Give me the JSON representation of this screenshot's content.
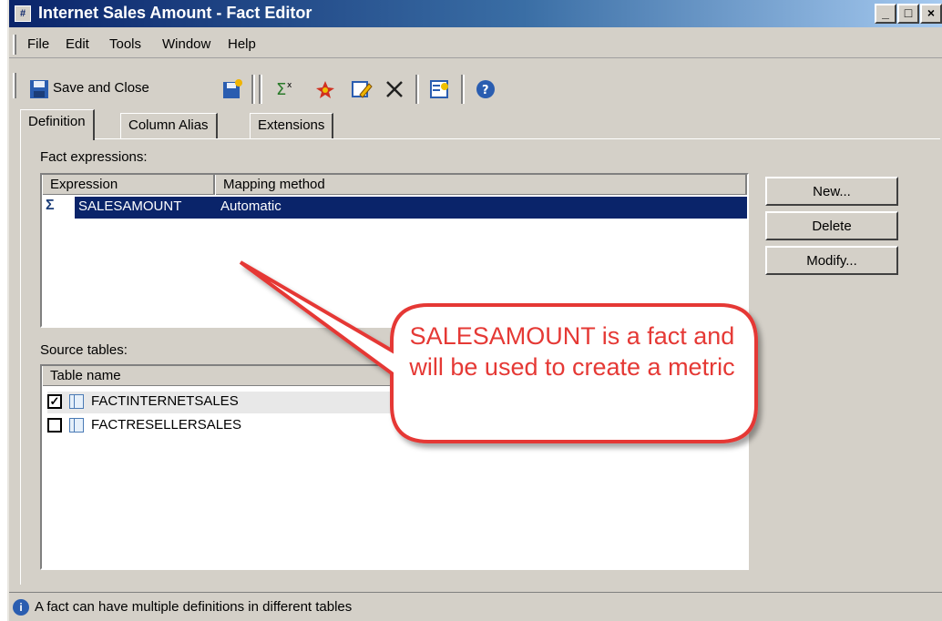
{
  "window": {
    "title": "Internet Sales Amount - Fact Editor",
    "app_icon": "#",
    "controls": [
      "_",
      "□",
      "×"
    ]
  },
  "menu": {
    "items": [
      "File",
      "Edit",
      "Tools",
      "Window",
      "Help"
    ]
  },
  "toolbar": {
    "save_close_label": "Save and Close",
    "icons": [
      "save-close-icon",
      "save-icon",
      "edit-expression-icon",
      "fact-wizard-icon",
      "modify-icon",
      "delete-icon",
      "properties-icon",
      "help-icon"
    ]
  },
  "tabs": [
    {
      "label": "Definition",
      "active": true
    },
    {
      "label": "Column Alias",
      "active": false
    },
    {
      "label": "Extensions",
      "active": false
    }
  ],
  "fact_expressions": {
    "label": "Fact expressions:",
    "columns": [
      "Expression",
      "Mapping method"
    ],
    "rows": [
      {
        "expression": "SALESAMOUNT",
        "mapping": "Automatic",
        "selected": true,
        "icon": "sigma-icon"
      }
    ]
  },
  "buttons": {
    "new": "New...",
    "delete": "Delete",
    "modify": "Modify..."
  },
  "source_tables": {
    "label": "Source tables:",
    "columns": [
      "Table name"
    ],
    "rows": [
      {
        "name": "FACTINTERNETSALES",
        "checked": true
      },
      {
        "name": "FACTRESELLERSALES",
        "checked": false
      }
    ]
  },
  "callout": {
    "text": "SALESAMOUNT is a fact and will be used to create a metric",
    "color": "#e53935"
  },
  "status": {
    "text": "A fact can have multiple definitions in different tables"
  },
  "colors": {
    "titlebar": "#0a246a",
    "selection": "#0a246a",
    "face": "#d4d0c8"
  }
}
